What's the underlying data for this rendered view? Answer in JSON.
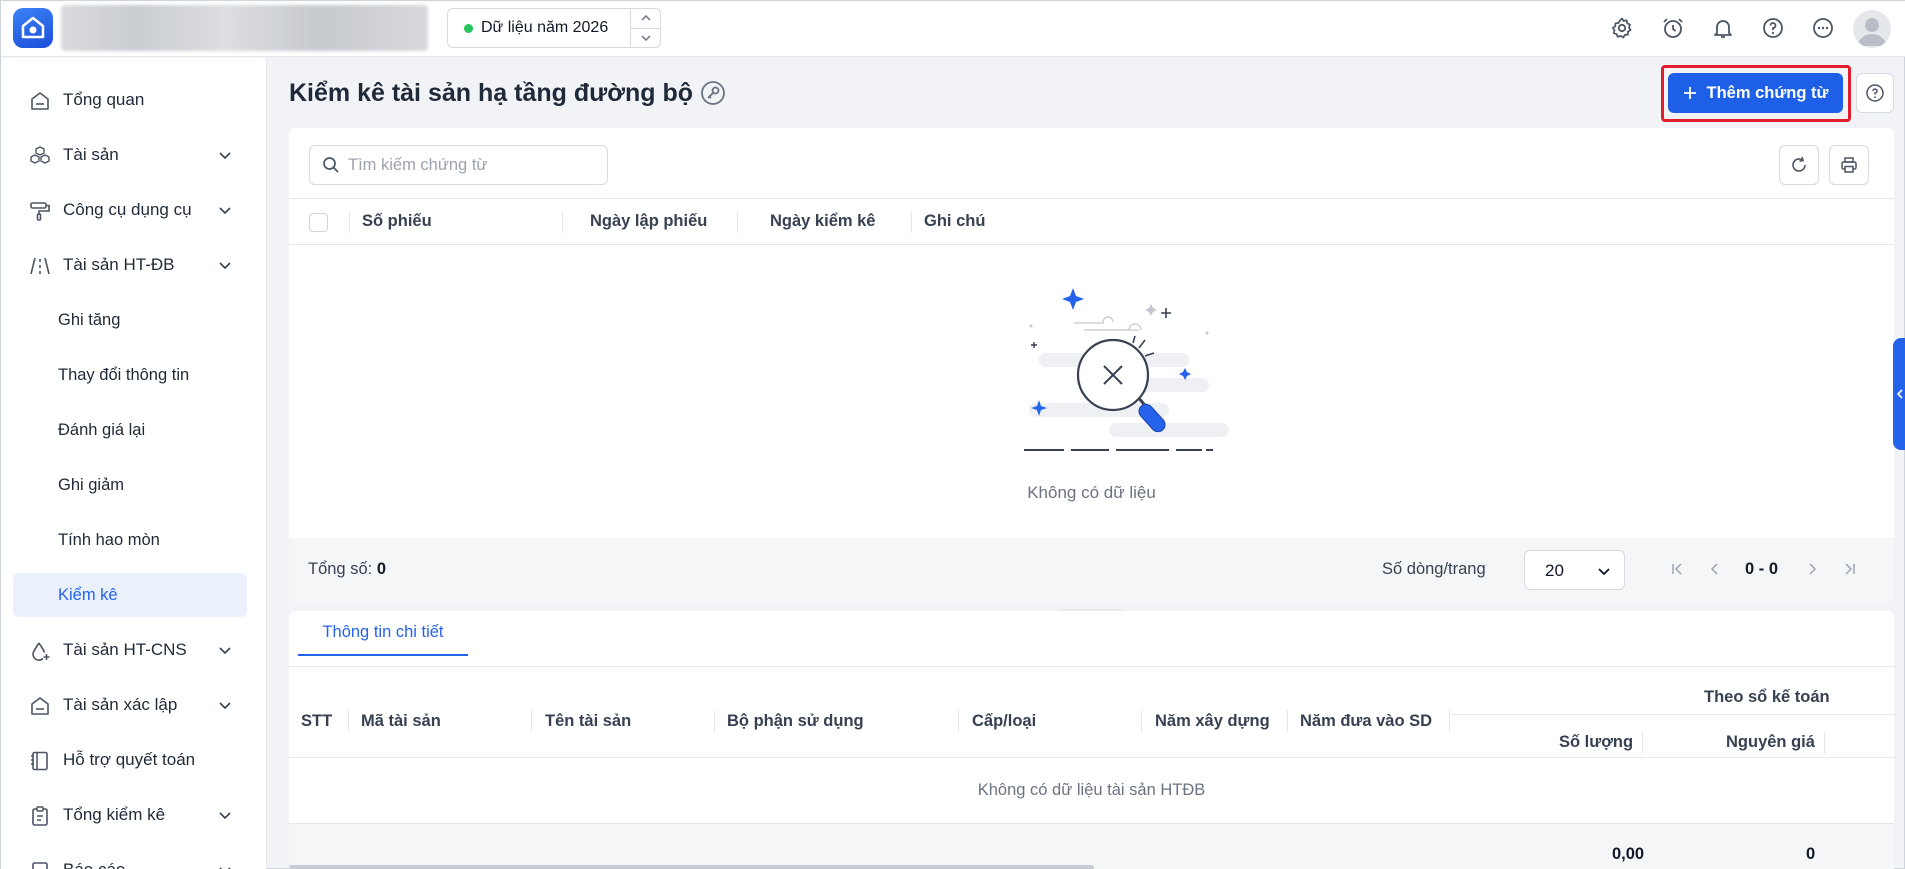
{
  "header": {
    "year_label": "Dữ liệu năm 2026",
    "icons": [
      "settings-icon",
      "alarm-clock-icon",
      "bell-icon",
      "help-circle-icon",
      "more-icon",
      "user-avatar"
    ]
  },
  "sidebar": {
    "items": [
      {
        "label": "Tổng quan",
        "icon": "home-icon"
      },
      {
        "label": "Tài sản",
        "icon": "cubes-icon",
        "expandable": true
      },
      {
        "label": "Công cụ dụng cụ",
        "icon": "paint-roller-icon",
        "expandable": true
      },
      {
        "label": "Tài sản HT-ĐB",
        "icon": "road-icon",
        "expandable": true,
        "expanded": true
      },
      {
        "label": "Ghi tăng",
        "sub": true
      },
      {
        "label": "Thay đổi thông tin",
        "sub": true
      },
      {
        "label": "Đánh giá lại",
        "sub": true
      },
      {
        "label": "Ghi giảm",
        "sub": true
      },
      {
        "label": "Tính hao mòn",
        "sub": true
      },
      {
        "label": "Kiểm kê",
        "sub": true,
        "active": true
      },
      {
        "label": "Tài sản HT-CNS",
        "icon": "water-drop-plus-icon",
        "expandable": true
      },
      {
        "label": "Tài sản xác lập",
        "icon": "home-icon",
        "expandable": true
      },
      {
        "label": "Hỗ trợ quyết toán",
        "icon": "notebook-icon"
      },
      {
        "label": "Tổng kiểm kê",
        "icon": "clipboard-icon",
        "expandable": true
      },
      {
        "label": "Báo cáo",
        "icon": "report-icon",
        "expandable": true
      }
    ]
  },
  "page": {
    "title": "Kiểm kê tài sản hạ tầng đường bộ",
    "add_button": "Thêm chứng từ"
  },
  "list": {
    "search_placeholder": "Tìm kiếm chứng từ",
    "columns": [
      "Số phiếu",
      "Ngày lập phiếu",
      "Ngày kiểm kê",
      "Ghi chú"
    ],
    "empty_text": "Không có dữ liệu",
    "total_label": "Tổng số:",
    "total_value": "0",
    "rows_per_page_label": "Số dòng/trang",
    "rows_per_page": "20",
    "range": "0 - 0"
  },
  "detail": {
    "tab": "Thông tin chi tiết",
    "columns": [
      "STT",
      "Mã tài sản",
      "Tên tài sản",
      "Bộ phận sử dụng",
      "Cấp/loại",
      "Năm xây dựng",
      "Năm đưa vào SD"
    ],
    "group_header": "Theo sổ kế toán",
    "sub_columns": [
      "Số lượng",
      "Nguyên giá"
    ],
    "empty_text": "Không có dữ liệu tài sản HTĐB",
    "totals": [
      "0,00",
      "0"
    ]
  },
  "colors": {
    "accent": "#1d5fe6",
    "highlight": "#e11d2e",
    "active_bg": "#eaf1fd"
  }
}
